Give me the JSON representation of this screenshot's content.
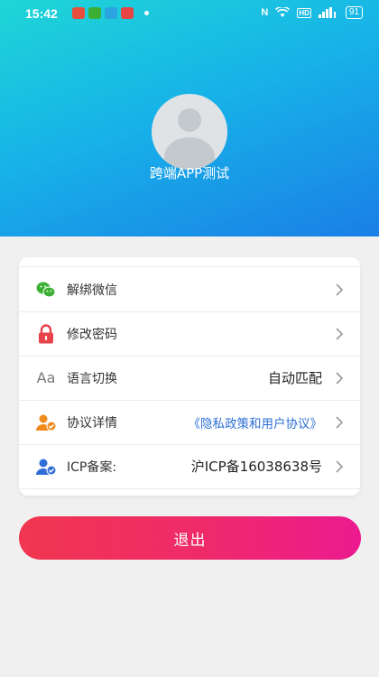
{
  "status_bar": {
    "time": "15:42",
    "battery": "91"
  },
  "profile": {
    "username": "跨端APP测试"
  },
  "menu": [
    {
      "icon": "wechat-icon",
      "label": "解绑微信",
      "value": ""
    },
    {
      "icon": "lock-icon",
      "label": "修改密码",
      "value": ""
    },
    {
      "icon": "language-icon",
      "label": "语言切换",
      "value": "自动匹配",
      "icon_text": "Aa"
    },
    {
      "icon": "user-agreement-icon",
      "label": "协议详情",
      "value": "《隐私政策和用户协议》"
    },
    {
      "icon": "user-verified-icon",
      "label": "ICP备案:",
      "value": "沪ICP备16038638号"
    }
  ],
  "logout": {
    "label": "退出"
  },
  "colors": {
    "header_gradient": [
      "#1fd6d6",
      "#1a7fe6"
    ],
    "logout_gradient": [
      "#f0364f",
      "#ec1a8f"
    ],
    "link": "#2d6fd6",
    "wechat": "#3cb034",
    "lock": "#e8424a",
    "agreement": "#f08a1c",
    "verified": "#2f6ed8"
  }
}
